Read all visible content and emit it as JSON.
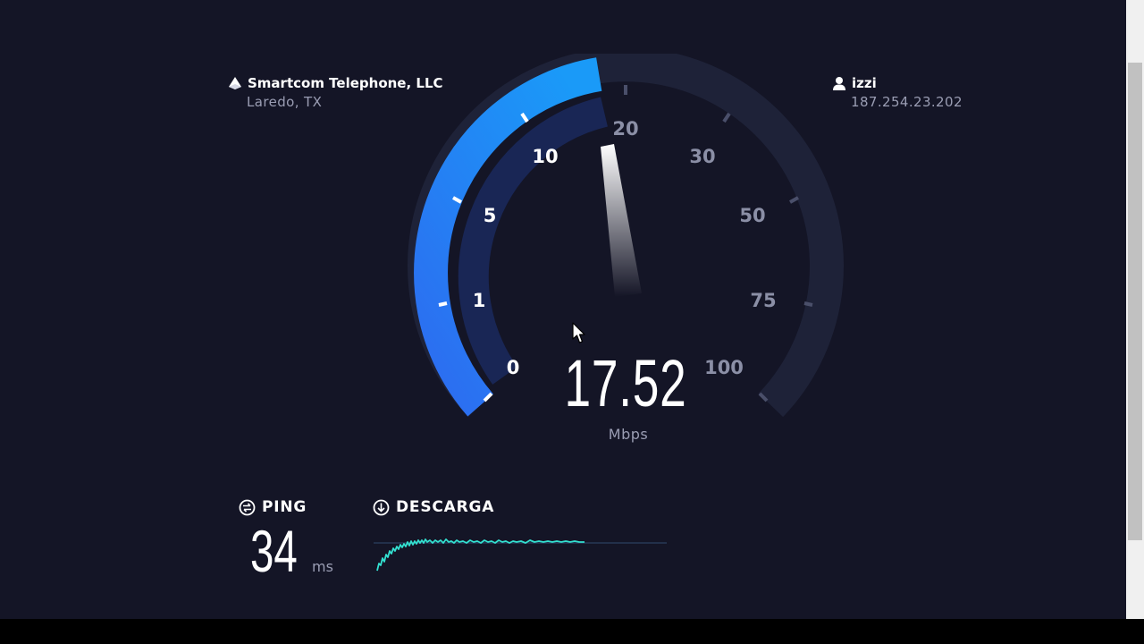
{
  "server": {
    "provider": "Smartcom Telephone, LLC",
    "location": "Laredo, TX",
    "icon": "server-triangle-icon"
  },
  "client": {
    "isp": "izzi",
    "ip": "187.254.23.202",
    "icon": "user-icon"
  },
  "gauge": {
    "labels": [
      "0",
      "1",
      "5",
      "10",
      "20",
      "30",
      "50",
      "75",
      "100"
    ],
    "active_color": "#1f8ef7",
    "inactive_color": "#1e2238"
  },
  "speed": {
    "value": "17.52",
    "unit": "Mbps"
  },
  "ping": {
    "label": "PING",
    "value": "34",
    "unit": "ms",
    "icon": "ping-icon"
  },
  "download": {
    "label": "DESCARGA",
    "icon": "download-icon",
    "graph_color": "#33e0d0"
  }
}
